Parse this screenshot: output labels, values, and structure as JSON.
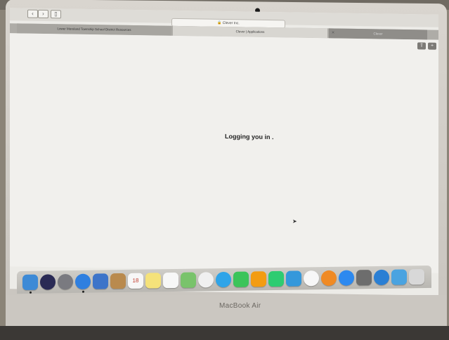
{
  "browser": {
    "address_bar_text": "🔒 Clever Inc.",
    "tabs": [
      {
        "label": "Lower Moreland Township School District Resources"
      },
      {
        "label": "Clever | Applications"
      },
      {
        "label": "Clever"
      }
    ]
  },
  "page": {
    "message": "Logging you in ."
  },
  "device": {
    "brand": "MacBook Air"
  },
  "dock": {
    "items": [
      {
        "name": "finder-icon",
        "color": "#3d8ad6",
        "round": false
      },
      {
        "name": "siri-icon",
        "color": "#2a2a55",
        "round": true
      },
      {
        "name": "launchpad-icon",
        "color": "#7a7a80",
        "round": true
      },
      {
        "name": "safari-icon",
        "color": "#2f7fe0",
        "round": true
      },
      {
        "name": "mail-icon",
        "color": "#3d74c9",
        "round": false
      },
      {
        "name": "contacts-icon",
        "color": "#b98a4e",
        "round": false
      },
      {
        "name": "calendar-icon",
        "color": "#f7f7f7",
        "round": false,
        "text": "18",
        "textColor": "#c0392b"
      },
      {
        "name": "notes-icon",
        "color": "#f5e27a",
        "round": false
      },
      {
        "name": "reminders-icon",
        "color": "#f7f7f7",
        "round": false
      },
      {
        "name": "maps-icon",
        "color": "#79c36b",
        "round": false
      },
      {
        "name": "photos-icon",
        "color": "#f0f0f0",
        "round": true
      },
      {
        "name": "messages-icon",
        "color": "#2fa4e8",
        "round": true
      },
      {
        "name": "facetime-icon",
        "color": "#3bc45a",
        "round": false
      },
      {
        "name": "pages-icon",
        "color": "#f39c12",
        "round": false
      },
      {
        "name": "numbers-icon",
        "color": "#2ecc71",
        "round": false
      },
      {
        "name": "keynote-icon",
        "color": "#3498db",
        "round": false
      },
      {
        "name": "itunes-icon",
        "color": "#f7f7f7",
        "round": true
      },
      {
        "name": "ibooks-icon",
        "color": "#f08a24",
        "round": true
      },
      {
        "name": "app-store-icon",
        "color": "#2d89ef",
        "round": true
      },
      {
        "name": "system-preferences-icon",
        "color": "#6d6d6d",
        "round": false
      },
      {
        "name": "globe-icon",
        "color": "#2a7fd4",
        "round": true
      },
      {
        "name": "downloads-icon",
        "color": "#4aa3e0",
        "round": false
      },
      {
        "name": "trash-icon",
        "color": "#d8d8d8",
        "round": false
      }
    ]
  }
}
